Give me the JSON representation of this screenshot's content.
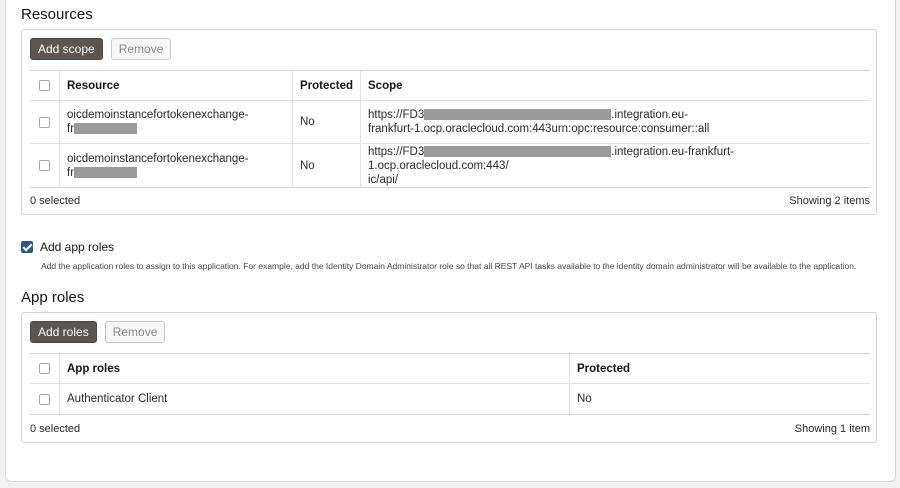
{
  "resources": {
    "title": "Resources",
    "add_label": "Add scope",
    "remove_label": "Remove",
    "columns": [
      "Resource",
      "Protected",
      "Scope"
    ],
    "rows": [
      {
        "resource_line1": "oicdemoinstancefortokenexchange-",
        "resource_line2": "fr",
        "protected": "No",
        "scope_prefix": "https://FD3",
        "scope_suffix_line1": ".integration.eu-",
        "scope_line2": "frankfurt-1.ocp.oraclecloud.com:443urn:opc:resource:consumer::all"
      },
      {
        "resource_line1": "oicdemoinstancefortokenexchange-",
        "resource_line2": "fr",
        "protected": "No",
        "scope_prefix": "https://FD3",
        "scope_suffix_line1": ".integration.eu-frankfurt-1.ocp.oraclecloud.com:443/",
        "scope_line2": "ic/api/"
      }
    ],
    "selected_text": "0 selected",
    "showing_text": "Showing 2 items"
  },
  "app_roles_option": {
    "checked": true,
    "label": "Add app roles",
    "help": "Add the application roles to assign to this application. For example, add the Identity Domain Administrator role so that all REST API tasks available to the identity domain administrator will be available to the application."
  },
  "app_roles": {
    "title": "App roles",
    "add_label": "Add roles",
    "remove_label": "Remove",
    "columns": [
      "App roles",
      "Protected"
    ],
    "rows": [
      {
        "name": "Authenticator Client",
        "protected": "No"
      }
    ],
    "selected_text": "0 selected",
    "showing_text": "Showing 1 item"
  },
  "colors": {
    "primary_button": "#5b5652",
    "checkbox_checked": "#2c5a80",
    "redaction": "#9a9a9a"
  }
}
